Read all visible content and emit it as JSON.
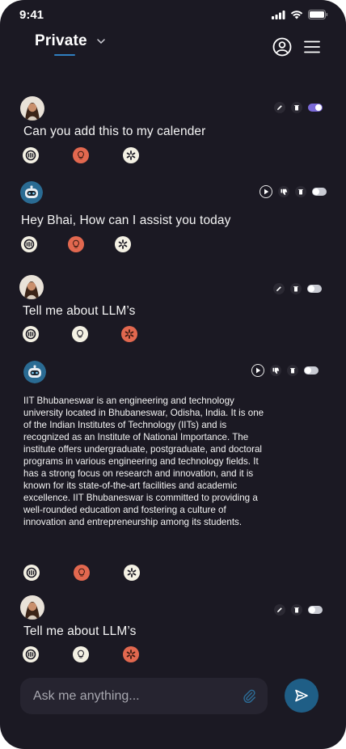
{
  "status_bar": {
    "time": "9:41"
  },
  "header": {
    "title": "Private"
  },
  "messages": [
    {
      "role": "user",
      "text": "Can you add this to my calender"
    },
    {
      "role": "assistant",
      "text": "Hey Bhai, How can I assist you today"
    },
    {
      "role": "user",
      "text": "Tell me about LLM’s"
    },
    {
      "role": "assistant",
      "text": "IIT Bhubaneswar is an engineering and technology university located in Bhubaneswar, Odisha, India. It is one of the Indian Institutes of Technology (IITs) and is recognized as an Institute of National Importance. The institute offers undergraduate, postgraduate, and doctoral programs in various engineering and technology fields. It has a strong focus on research and innovation, and it is known for its state-of-the-art facilities and academic excellence. IIT Bhubaneswar is committed to providing a well-rounded education and fostering a culture of innovation and entrepreneurship among its students."
    },
    {
      "role": "user",
      "text": "Tell me about LLM’s"
    }
  ],
  "composer": {
    "placeholder": "Ask me anything..."
  },
  "colors": {
    "background": "#1b1923",
    "accent_blue": "#2f7fc0",
    "send_button": "#1f5e86",
    "model_orange": "#e2684f",
    "model_cream": "#f4f1e4",
    "toggle_on": "#7b6ad8"
  },
  "icons": [
    "avatar",
    "bot-avatar",
    "profile-icon",
    "menu-icon",
    "chevron-down-icon",
    "edit-icon",
    "trash-icon",
    "toggle",
    "play-icon",
    "thumbs-down-icon",
    "model-icon",
    "bulb-icon",
    "openai-icon",
    "paperclip-icon",
    "send-icon"
  ]
}
